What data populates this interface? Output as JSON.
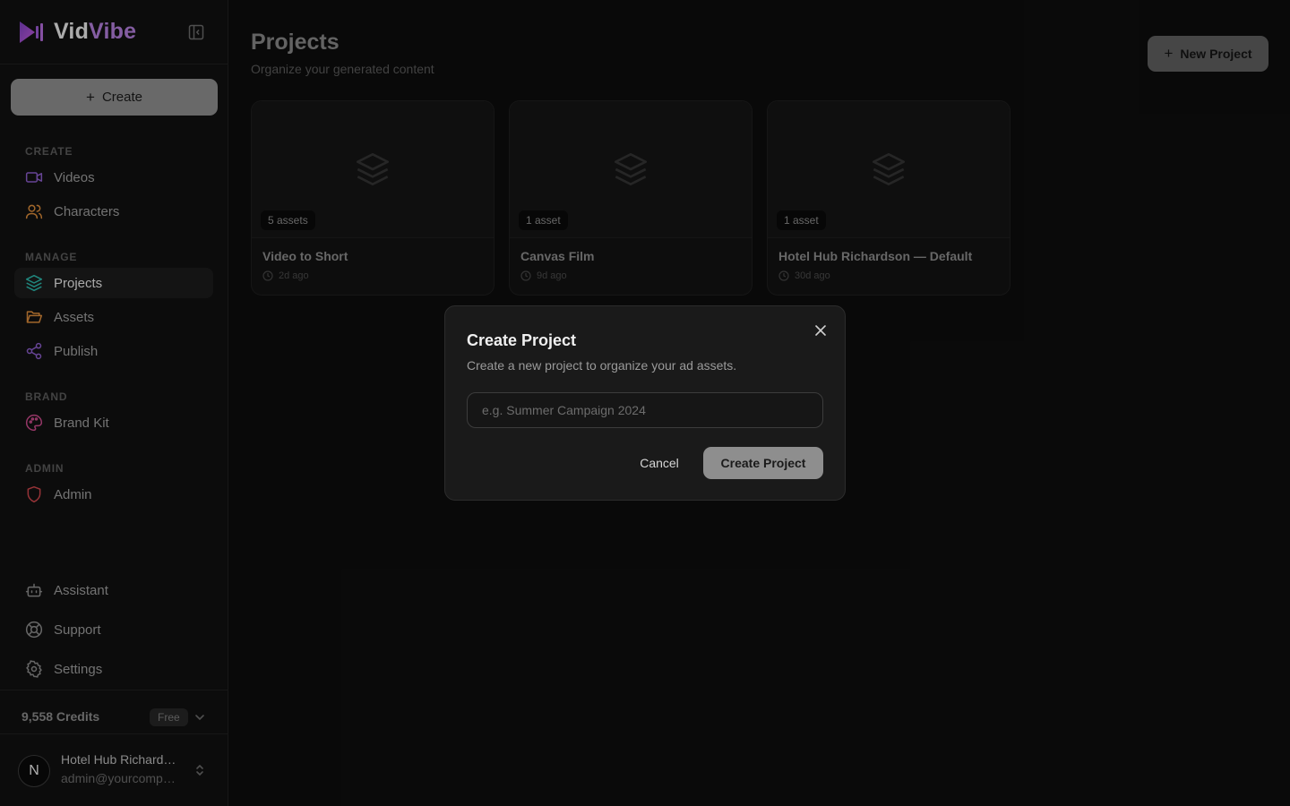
{
  "brand": {
    "name_a": "Vid",
    "name_b": "Vibe"
  },
  "sidebar": {
    "create_button": "Create",
    "sections": {
      "create": "CREATE",
      "manage": "MANAGE",
      "brand": "BRAND",
      "admin": "ADMIN"
    },
    "items": {
      "videos": "Videos",
      "characters": "Characters",
      "projects": "Projects",
      "assets": "Assets",
      "publish": "Publish",
      "brand_kit": "Brand Kit",
      "admin": "Admin",
      "assistant": "Assistant",
      "support": "Support",
      "settings": "Settings"
    },
    "credits": "9,558 Credits",
    "plan": "Free",
    "user": {
      "initial": "N",
      "name": "Hotel Hub Richardson",
      "email": "admin@yourcompany.com"
    }
  },
  "main": {
    "title": "Projects",
    "subtitle": "Organize your generated content",
    "new_project_button": "New Project",
    "projects": [
      {
        "assets": "5 assets",
        "title": "Video to Short",
        "time": "2d ago"
      },
      {
        "assets": "1 asset",
        "title": "Canvas Film",
        "time": "9d ago"
      },
      {
        "assets": "1 asset",
        "title": "Hotel Hub Richardson — Default",
        "time": "30d ago"
      }
    ]
  },
  "modal": {
    "title": "Create Project",
    "description": "Create a new project to organize your ad assets.",
    "input_value": "",
    "input_placeholder": "e.g. Summer Campaign 2024",
    "cancel": "Cancel",
    "submit": "Create Project"
  },
  "colors": {
    "accent_purple": "#b07cd8",
    "teal": "#2bb5a8",
    "orange": "#d98a3a",
    "violet": "#8a5cc8",
    "pink": "#c84a8a",
    "red": "#c8444a"
  }
}
